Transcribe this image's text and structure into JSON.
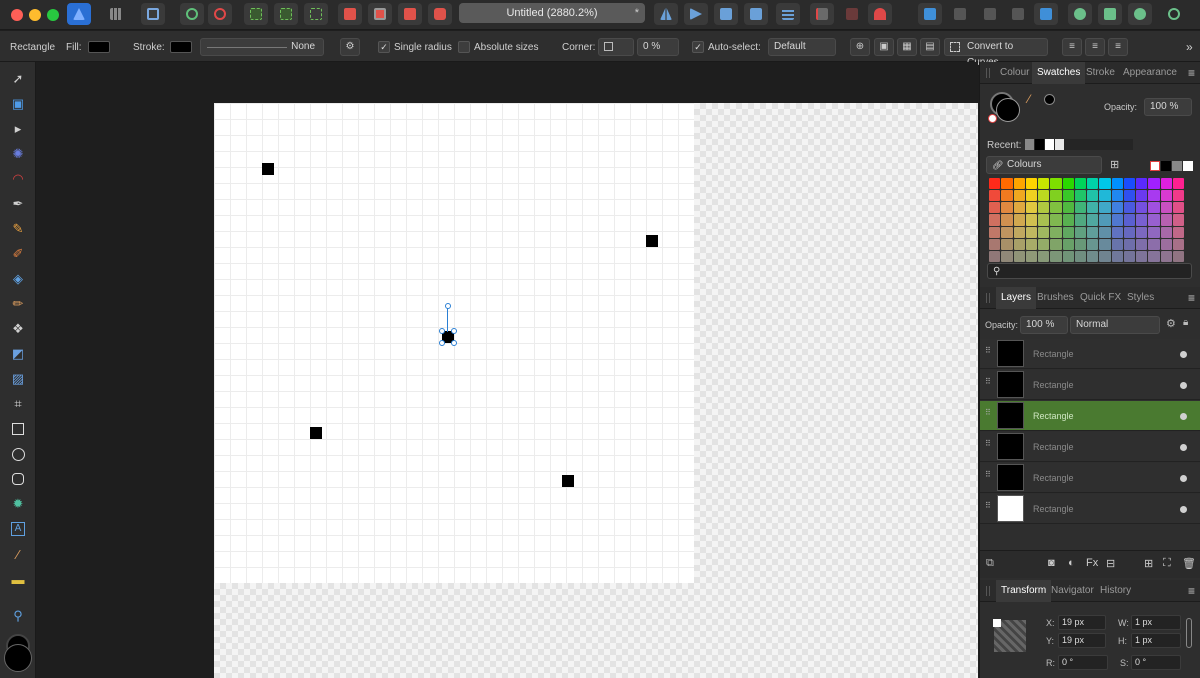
{
  "window": {
    "document_title": "Untitled (2880.2%)",
    "traffic_colors": [
      "#fe5f57",
      "#febc2e",
      "#28c840"
    ]
  },
  "context_bar": {
    "tool_name": "Rectangle",
    "fill_label": "Fill:",
    "stroke_label": "Stroke:",
    "stroke_style_value": "None",
    "single_radius_label": "Single radius",
    "absolute_sizes_label": "Absolute sizes",
    "corner_label": "Corner:",
    "corner_value": "0 %",
    "auto_select_label": "Auto-select:",
    "auto_select_value": "Default",
    "convert_label": "Convert to Curves"
  },
  "colour_panel": {
    "tabs": [
      "Colour",
      "Swatches",
      "Stroke",
      "Appearance"
    ],
    "active_tab": "Swatches",
    "opacity_label": "Opacity:",
    "opacity_value": "100 %",
    "recent_label": "Recent:",
    "palette_name": "Colours",
    "palette_colors": [
      "#ff2a1a",
      "#ff6a00",
      "#ffa500",
      "#ffd200",
      "#c8e600",
      "#7ee000",
      "#2bd800",
      "#00d45a",
      "#00d2a8",
      "#00c8e8",
      "#0090ff",
      "#1a4dff",
      "#5a2aff",
      "#a020ff",
      "#e020e0",
      "#ff2090",
      "#f04a3a",
      "#f07a20",
      "#f0a820",
      "#f0d020",
      "#bcd820",
      "#80d020",
      "#3ac828",
      "#20c468",
      "#20c2a8",
      "#20b8d8",
      "#2088f0",
      "#3050f0",
      "#6a3af0",
      "#a83af0",
      "#d83ad0",
      "#f03a8a",
      "#e06050",
      "#e08840",
      "#e0a840",
      "#e0c840",
      "#b0c840",
      "#80c040",
      "#50b840",
      "#40b478",
      "#40b2a8",
      "#40a8c8",
      "#4080e0",
      "#4a5ae0",
      "#7450e0",
      "#a050e0",
      "#c850c0",
      "#e05088",
      "#d07060",
      "#d09050",
      "#d0a850",
      "#d0c050",
      "#a8c050",
      "#80b850",
      "#58b050",
      "#50a880",
      "#50a8a0",
      "#509ab8",
      "#5078d0",
      "#5a60d0",
      "#7860d0",
      "#9860d0",
      "#b860b0",
      "#d06088",
      "#c07868",
      "#c09460",
      "#c0a860",
      "#c0b860",
      "#a0b860",
      "#80b060",
      "#60a860",
      "#60a080",
      "#609e9a",
      "#6090a8",
      "#6072c0",
      "#6668c0",
      "#7c68c0",
      "#9068c0",
      "#a868a8",
      "#c06888",
      "#a87870",
      "#a89068",
      "#a8a068",
      "#a8ac68",
      "#94ac68",
      "#80a468",
      "#68a068",
      "#689878",
      "#689690",
      "#688a9c",
      "#6874aa",
      "#6e6eaa",
      "#7e6eaa",
      "#8c6eaa",
      "#9c6e9e",
      "#a87088",
      "#907878",
      "#908878",
      "#909478",
      "#909a78",
      "#889a78",
      "#7c9678",
      "#709478",
      "#708e80",
      "#708c8c",
      "#708490",
      "#70789a",
      "#74749a",
      "#7e749a",
      "#86749a",
      "#8e7490",
      "#907482"
    ]
  },
  "layers_panel": {
    "tabs": [
      "Layers",
      "Brushes",
      "Quick FX",
      "Styles"
    ],
    "active_tab": "Layers",
    "opacity_label": "Opacity:",
    "opacity_value": "100 %",
    "blend_mode": "Normal",
    "layers": [
      {
        "name": "Rectangle",
        "thumb": "#000000",
        "selected": false
      },
      {
        "name": "Rectangle",
        "thumb": "#000000",
        "selected": false
      },
      {
        "name": "Rectangle",
        "thumb": "#000000",
        "selected": true
      },
      {
        "name": "Rectangle",
        "thumb": "#000000",
        "selected": false
      },
      {
        "name": "Rectangle",
        "thumb": "#000000",
        "selected": false
      },
      {
        "name": "Rectangle",
        "thumb": "#ffffff",
        "selected": false
      }
    ]
  },
  "transform_panel": {
    "tabs": [
      "Transform",
      "Navigator",
      "History"
    ],
    "active_tab": "Transform",
    "x_label": "X:",
    "x_value": "19 px",
    "y_label": "Y:",
    "y_value": "19 px",
    "w_label": "W:",
    "w_value": "1 px",
    "h_label": "H:",
    "h_value": "1 px",
    "r_label": "R:",
    "r_value": "0 °",
    "s_label": "S:",
    "s_value": "0 °"
  },
  "icons": {
    "selection_color": "#2a7fd4",
    "selected_layer_color": "#4a7a30"
  }
}
